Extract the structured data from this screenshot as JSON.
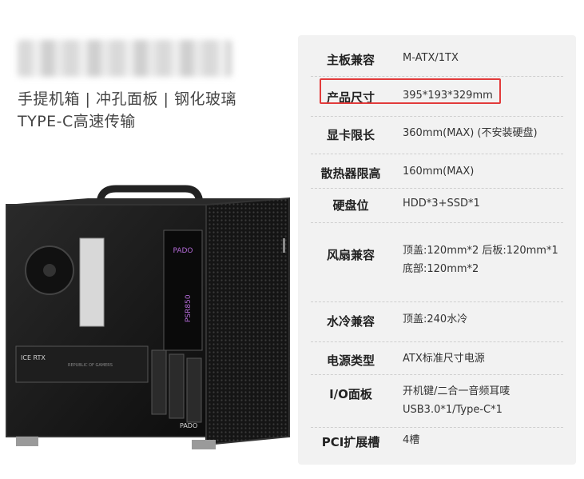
{
  "tagline": {
    "line1": "手提机箱 | 冲孔面板 | 钢化玻璃",
    "line2": "TYPE-C高速传输"
  },
  "product_image": {
    "psu_brand": "PADO",
    "psu_model": "PSR850",
    "gpu_text": "ICE RTX",
    "gpu_subtext": "REPUBLIC OF GAMERS",
    "case_logo": "PADO"
  },
  "specs": [
    {
      "label": "主板兼容",
      "lines": [
        "M-ATX/1TX"
      ]
    },
    {
      "label": "产品尺寸",
      "lines": [
        "395*193*329mm"
      ]
    },
    {
      "label": "显卡限长",
      "lines": [
        "360mm(MAX) (不安装硬盘)"
      ]
    },
    {
      "label": "散热器限高",
      "lines": [
        "160mm(MAX)"
      ]
    },
    {
      "label": "硬盘位",
      "lines": [
        "HDD*3+SSD*1"
      ]
    },
    {
      "label": "风扇兼容",
      "lines": [
        "顶盖:120mm*2 后板:120mm*1",
        "底部:120mm*2"
      ]
    },
    {
      "label": "水冷兼容",
      "lines": [
        "顶盖:240水冷"
      ]
    },
    {
      "label": "电源类型",
      "lines": [
        "ATX标准尺寸电源"
      ]
    },
    {
      "label": "I/O面板",
      "lines": [
        "开机键/二合一音频耳唛",
        "USB3.0*1/Type-C*1"
      ]
    },
    {
      "label": "PCI扩展槽",
      "lines": [
        "4槽"
      ]
    }
  ],
  "colors": {
    "panel_bg": "#f2f2f2",
    "highlight_border": "#e23b3b",
    "case_body": "#1b1b1b"
  }
}
